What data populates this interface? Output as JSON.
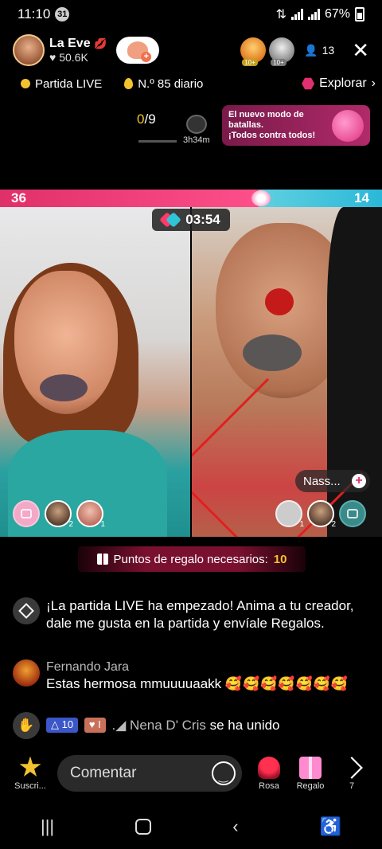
{
  "status": {
    "time": "11:10",
    "notif_badge": "31",
    "battery": "67%"
  },
  "host": {
    "name": "La Eve",
    "likes": "50.6K"
  },
  "viewers": {
    "top1_level": "10+",
    "top2_level": "10+",
    "count": "13"
  },
  "chips": {
    "live_match": "Partida LIVE",
    "daily_rank": "N.º 85 diario",
    "explore": "Explorar"
  },
  "progress": {
    "current": "0",
    "total": "/9",
    "timer": "3h34m"
  },
  "promo": {
    "line1": "El nuevo modo de batallas.",
    "line2": "¡Todos contra todos!"
  },
  "battle": {
    "left_score": "36",
    "right_score": "14",
    "timer": "03:54"
  },
  "guest_tag": "Nass...",
  "gifters": {
    "left_rank2": "2",
    "left_rank1": "1",
    "right_rank1": "1",
    "right_rank2": "2"
  },
  "points_banner": {
    "label": "Puntos de regalo necesarios:",
    "value": "10"
  },
  "chat": [
    {
      "text": "¡La partida LIVE ha empezado! Anima a tu creador, dale me gusta en la partida y envíale Regalos."
    },
    {
      "user": "Fernando Jara",
      "text": "Estas hermosa mmuuuuaakk",
      "emojis": "🥰🥰🥰🥰🥰🥰🥰"
    },
    {
      "badge1": "10",
      "badge2": "I",
      "user": "Nena D' Cris",
      "text": "se ha unido"
    }
  ],
  "bottom": {
    "subscribe_label": "Suscri...",
    "comment_placeholder": "Comentar",
    "rose_label": "Rosa",
    "gift_label": "Regalo",
    "share_count": "7"
  }
}
